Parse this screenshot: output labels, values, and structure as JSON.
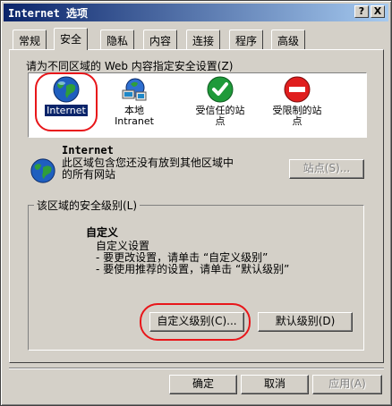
{
  "window": {
    "title": "Internet 选项",
    "help_button": "?",
    "close_button": "X"
  },
  "tabs": [
    "常规",
    "安全",
    "隐私",
    "内容",
    "连接",
    "程序",
    "高级"
  ],
  "active_tab": "安全",
  "zones_prompt": "请为不同区域的 Web 内容指定安全设置(Z)",
  "zones": [
    {
      "name": "Internet",
      "icon": "globe-icon",
      "selected": true
    },
    {
      "name": "本地\nIntranet",
      "icon": "intranet-icon",
      "selected": false
    },
    {
      "name": "受信任的站\n点",
      "icon": "trusted-check-icon",
      "selected": false
    },
    {
      "name": "受限制的站\n点",
      "icon": "restricted-no-icon",
      "selected": false
    }
  ],
  "zone_info": {
    "title": "Internet",
    "description": "此区域包含您还没有放到其他区域中的所有网站",
    "sites_button": "站点(S)..."
  },
  "security_level": {
    "group_title": "该区域的安全级别(L)",
    "level_name": "自定义",
    "lines": [
      "自定义设置",
      "- 要更改设置，请单击 “自定义级别”",
      "- 要使用推荐的设置，请单击 “默认级别”"
    ],
    "custom_button": "自定义级别(C)...",
    "default_button": "默认级别(D)"
  },
  "footer": {
    "ok": "确定",
    "cancel": "取消",
    "apply": "应用(A)"
  },
  "colors": {
    "titlebar_start": "#0a246a",
    "titlebar_end": "#a6caf0",
    "highlight_ring": "#e8161a",
    "selection": "#0a246a"
  }
}
